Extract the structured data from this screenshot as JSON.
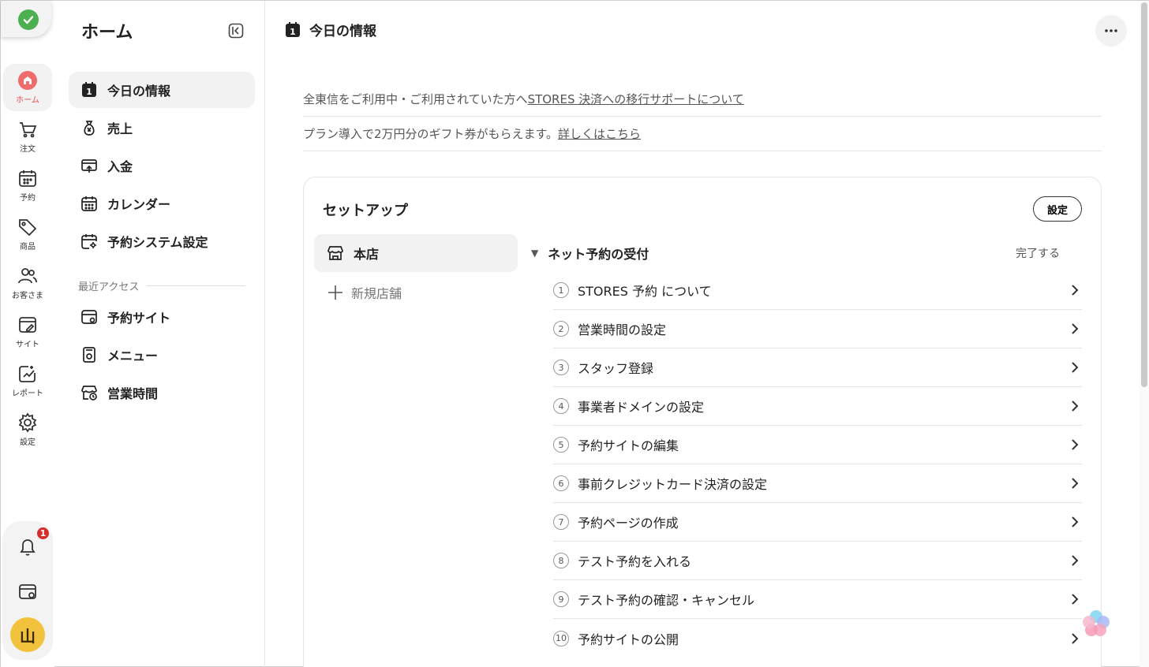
{
  "rail": {
    "items": [
      {
        "label": "ホーム",
        "icon": "home-icon"
      },
      {
        "label": "注文",
        "icon": "cart-icon"
      },
      {
        "label": "予約",
        "icon": "calendar-icon"
      },
      {
        "label": "商品",
        "icon": "tag-icon"
      },
      {
        "label": "お客さま",
        "icon": "users-icon"
      },
      {
        "label": "サイト",
        "icon": "site-edit-icon"
      },
      {
        "label": "レポート",
        "icon": "report-icon"
      },
      {
        "label": "設定",
        "icon": "gear-icon"
      }
    ],
    "notification_count": "1",
    "avatar_initial": "山"
  },
  "sidebar": {
    "title": "ホーム",
    "items": [
      {
        "label": "今日の情報",
        "icon": "calendar-day-icon"
      },
      {
        "label": "売上",
        "icon": "money-bag-icon"
      },
      {
        "label": "入金",
        "icon": "deposit-icon"
      },
      {
        "label": "カレンダー",
        "icon": "calendar-icon"
      },
      {
        "label": "予約システム設定",
        "icon": "calendar-settings-icon"
      }
    ],
    "recent_label": "最近アクセス",
    "recent_items": [
      {
        "label": "予約サイト",
        "icon": "site-icon"
      },
      {
        "label": "メニュー",
        "icon": "menu-icon"
      },
      {
        "label": "営業時間",
        "icon": "store-clock-icon"
      }
    ]
  },
  "main": {
    "title": "今日の情報",
    "date_day": "1",
    "notices": [
      {
        "text": "全東信をご利用中・ご利用されていた方へ",
        "link": "STORES 決済への移行サポートについて"
      },
      {
        "text": "プラン導入で2万円分のギフト券がもらえます。",
        "link": "詳しくはこちら"
      }
    ],
    "setup": {
      "title": "セットアップ",
      "settings_button": "設定",
      "store_tab": "本店",
      "new_store": "新規店舗",
      "group_title": "ネット予約の受付",
      "complete_label": "完了する",
      "steps": [
        {
          "num": "1",
          "label": "STORES 予約 について"
        },
        {
          "num": "2",
          "label": "営業時間の設定"
        },
        {
          "num": "3",
          "label": "スタッフ登録"
        },
        {
          "num": "4",
          "label": "事業者ドメインの設定"
        },
        {
          "num": "5",
          "label": "予約サイトの編集"
        },
        {
          "num": "6",
          "label": "事前クレジットカード決済の設定"
        },
        {
          "num": "7",
          "label": "予約ページの作成"
        },
        {
          "num": "8",
          "label": "テスト予約を入れる"
        },
        {
          "num": "9",
          "label": "テスト予約の確認・キャンセル"
        },
        {
          "num": "10",
          "label": "予約サイトの公開"
        }
      ]
    }
  },
  "colors": {
    "accent": "#e64a4a",
    "badge": "#d32f2f",
    "avatar": "#f3c23d",
    "success": "#4caf50"
  }
}
